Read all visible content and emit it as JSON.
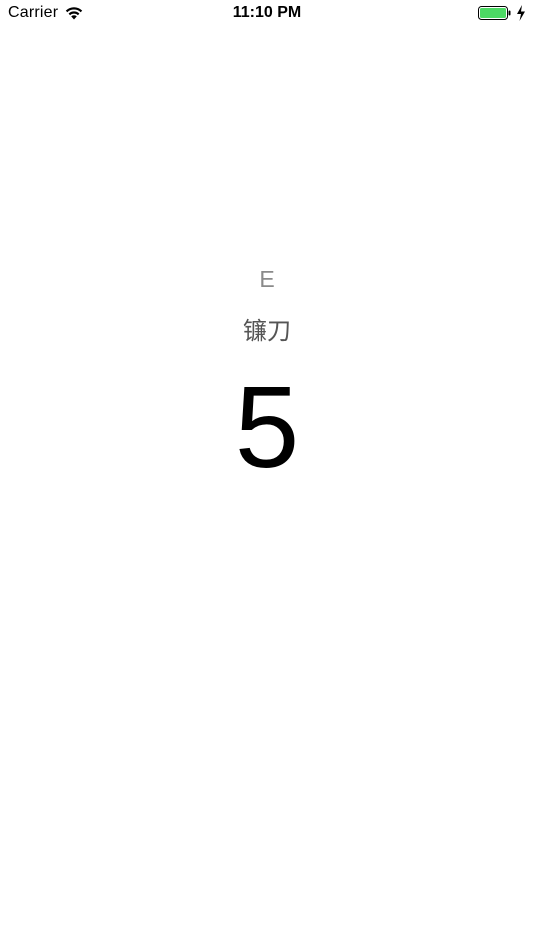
{
  "status_bar": {
    "carrier": "Carrier",
    "time": "11:10 PM",
    "battery_color": "#4cd964",
    "icons": [
      "wifi-icon",
      "battery-icon",
      "charging-bolt-icon"
    ]
  },
  "main": {
    "letter": "E",
    "word": "镰刀",
    "number": "5"
  }
}
